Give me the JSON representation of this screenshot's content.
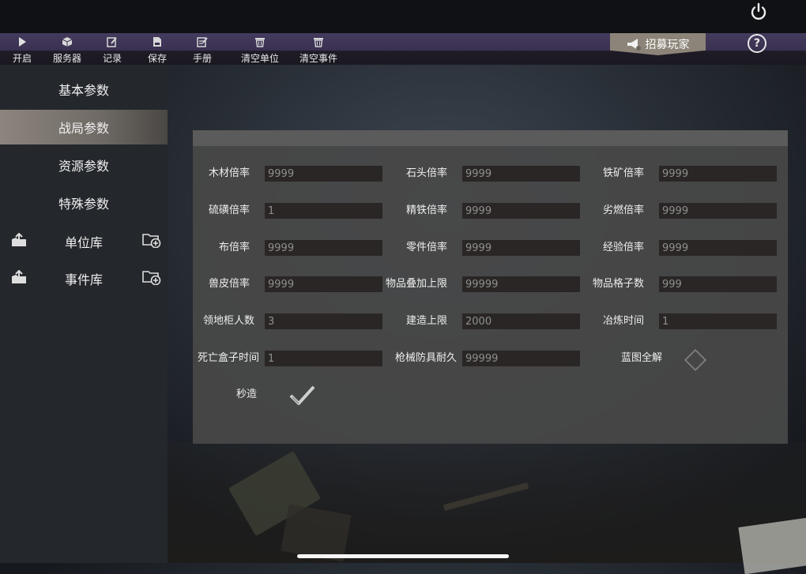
{
  "toolbar": {
    "items": [
      {
        "label": "开启",
        "icon": "play-icon"
      },
      {
        "label": "服务器",
        "icon": "cube-icon"
      },
      {
        "label": "记录",
        "icon": "edit-icon"
      },
      {
        "label": "保存",
        "icon": "save-icon"
      },
      {
        "label": "手册",
        "icon": "manual-icon"
      },
      {
        "label": "清空单位",
        "icon": "trash-icon"
      },
      {
        "label": "清空事件",
        "icon": "trash-icon"
      }
    ],
    "recruit_label": "招募玩家",
    "help_label": "?"
  },
  "sidebar": {
    "items": [
      {
        "label": "基本参数"
      },
      {
        "label": "战局参数",
        "active": true
      },
      {
        "label": "资源参数"
      },
      {
        "label": "特殊参数"
      },
      {
        "label": "单位库"
      },
      {
        "label": "事件库"
      }
    ]
  },
  "fields": [
    {
      "label": "木材倍率",
      "value": "9999"
    },
    {
      "label": "石头倍率",
      "value": "9999"
    },
    {
      "label": "铁矿倍率",
      "value": "9999"
    },
    {
      "label": "硫磺倍率",
      "value": "1"
    },
    {
      "label": "精铁倍率",
      "value": "9999"
    },
    {
      "label": "劣燃倍率",
      "value": "9999"
    },
    {
      "label": "布倍率",
      "value": "9999"
    },
    {
      "label": "零件倍率",
      "value": "9999"
    },
    {
      "label": "经验倍率",
      "value": "9999"
    },
    {
      "label": "兽皮倍率",
      "value": "9999"
    },
    {
      "label": "物品叠加上限",
      "value": "99999"
    },
    {
      "label": "物品格子数",
      "value": "999"
    },
    {
      "label": "领地柜人数",
      "value": "3"
    },
    {
      "label": "建造上限",
      "value": "2000"
    },
    {
      "label": "冶炼时间",
      "value": "1"
    },
    {
      "label": "死亡盒子时间",
      "value": "1"
    },
    {
      "label": "枪械防具耐久",
      "value": "99999"
    }
  ],
  "toggles": {
    "blueprint_label": "蓝图全解",
    "blueprint_checked": false,
    "instant_label": "秒造",
    "instant_checked": true
  },
  "colors": {
    "toolbar": "#3a3050",
    "active_tab": "#8c857d",
    "panel": "#484848",
    "input_bg": "#2b2626",
    "input_text": "#8f8f8f"
  }
}
